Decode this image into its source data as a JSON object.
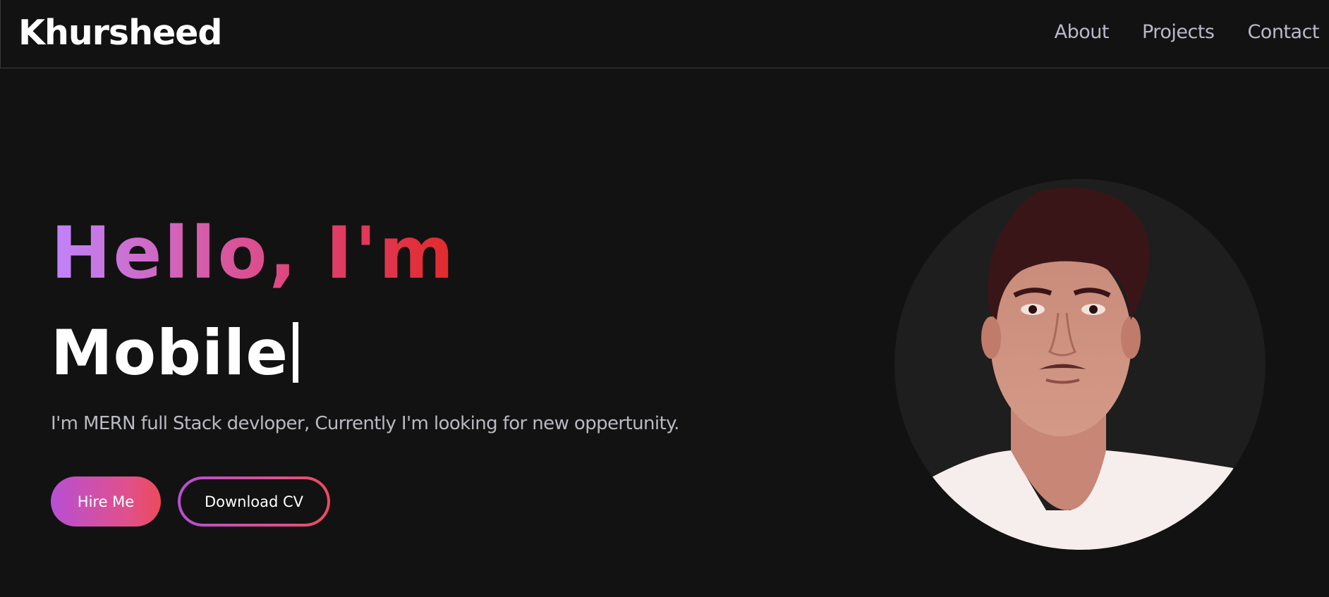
{
  "navbar": {
    "brand": "Khursheed",
    "links": [
      {
        "label": "About"
      },
      {
        "label": "Projects"
      },
      {
        "label": "Contact"
      }
    ]
  },
  "hero": {
    "greeting": "Hello, I'm",
    "typed_text": "Mobile",
    "subtitle": "I'm MERN full Stack devloper, Currently I'm looking for new oppertunity.",
    "hire_button": "Hire Me",
    "cv_button": "Download CV"
  },
  "colors": {
    "background": "#121212",
    "gradient_start": "#c084fc",
    "gradient_end": "#e12a2a",
    "nav_text": "#b9b9c9"
  }
}
